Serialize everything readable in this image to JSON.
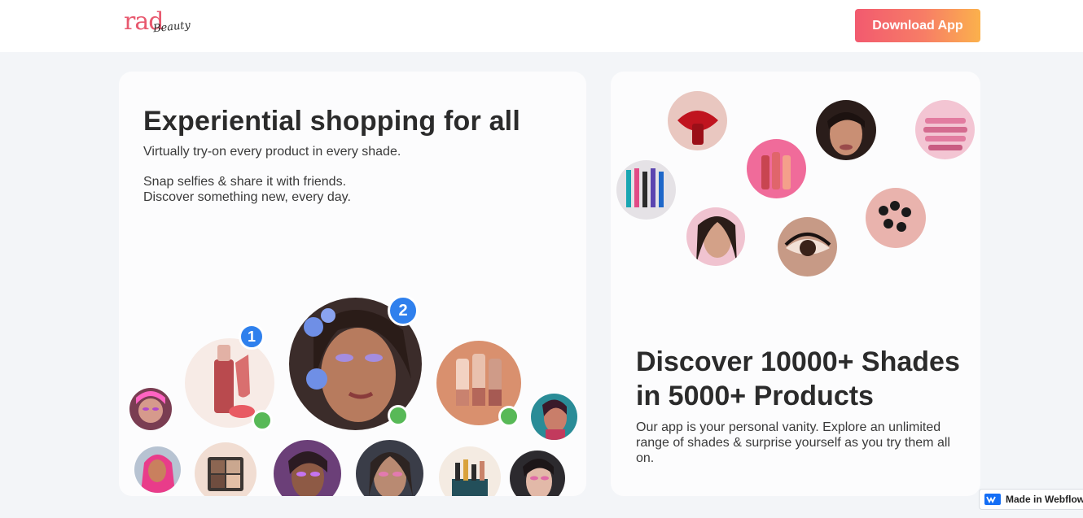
{
  "header": {
    "logo_main": "rad",
    "logo_sub": "Beauty",
    "download_label": "Download App"
  },
  "left_card": {
    "title": "Experiential shopping for all",
    "subtitle": "Virtually try-on every product in every shade.",
    "line1": "Snap selfies & share it with friends.",
    "line2": "Discover something new, every day.",
    "badge1": "1",
    "badge2": "2"
  },
  "right_card": {
    "title": "Discover 10000+ Shades in 5000+ Products",
    "description": "Our app is your personal vanity. Explore an unlimited range of shades & surprise yourself as you try them all on."
  },
  "footer_badge": {
    "label": "Made in Webflow",
    "icon": "webflow-logo-icon"
  },
  "colors": {
    "accent_gradient": [
      "#f25a6f",
      "#fbb14c"
    ],
    "badge_blue": "#2f80ed",
    "status_green": "#58b957"
  }
}
